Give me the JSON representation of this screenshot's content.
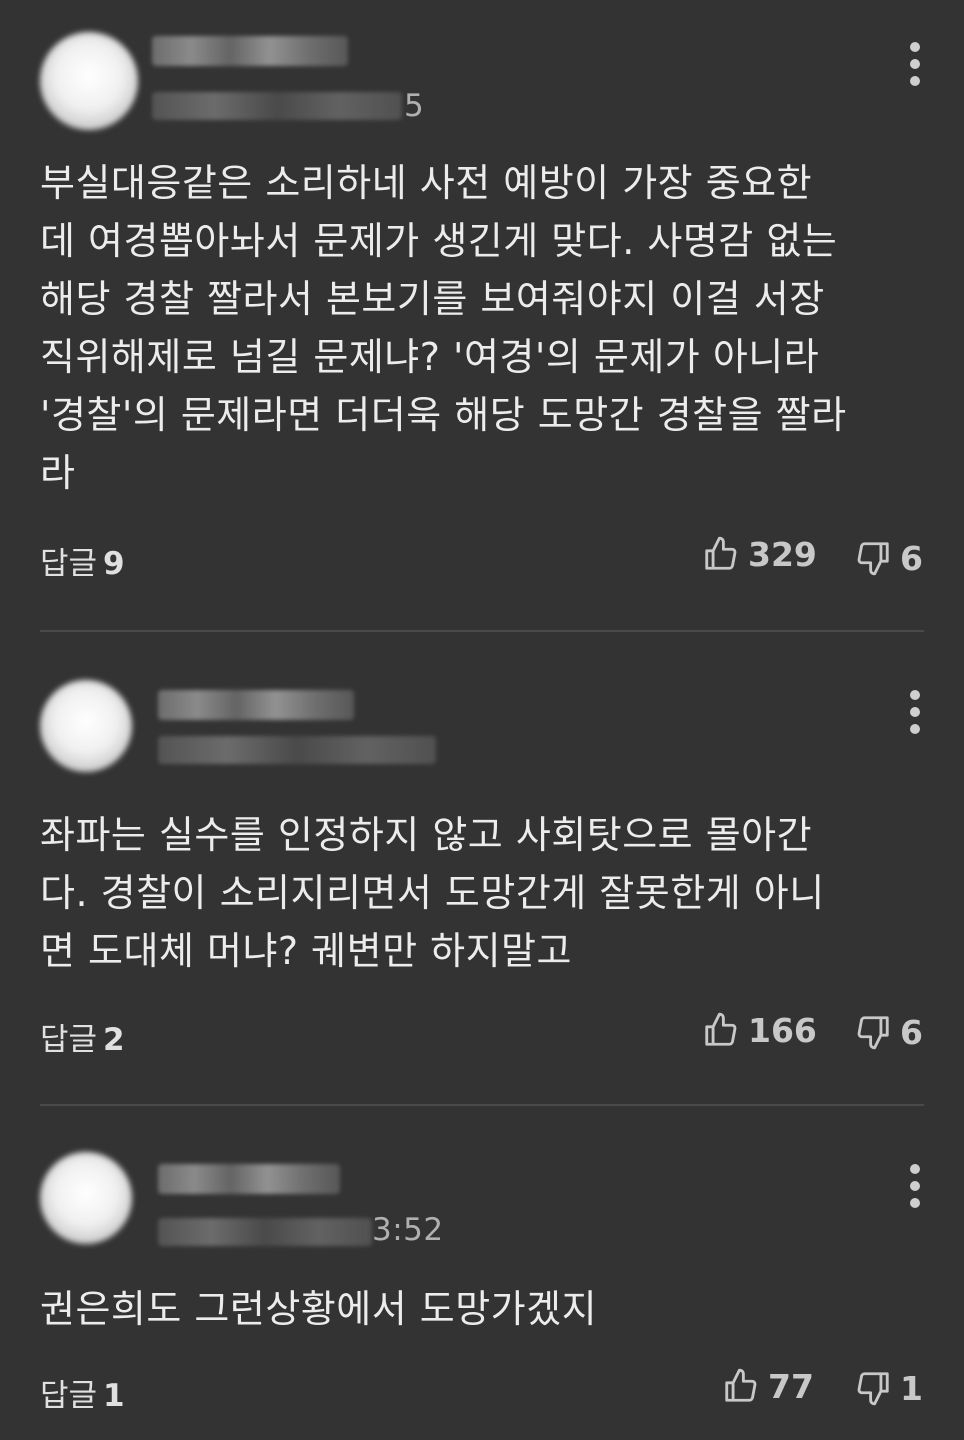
{
  "comments": [
    {
      "time_tail": "5",
      "text": "부실대응같은 소리하네 사전 예방이 가장 중요한\n데 여경뽑아놔서 문제가 생긴게 맞다. 사명감 없는\n해당 경찰 짤라서 본보기를 보여줘야지 이걸 서장\n직위해제로 넘길 문제냐? '여경'의 문제가 아니라\n'경찰'의 문제라면 더더욱 해당 도망간 경찰을 짤라\n라",
      "replies_label": "답글",
      "replies_count": "9",
      "likes": "329",
      "dislikes": "6"
    },
    {
      "time_tail": "",
      "text": "좌파는 실수를 인정하지 않고 사회탓으로 몰아간\n다. 경찰이 소리지리면서 도망간게 잘못한게 아니\n면 도대체 머냐? 궤변만 하지말고",
      "replies_label": "답글",
      "replies_count": "2",
      "likes": "166",
      "dislikes": "6"
    },
    {
      "time_tail": "3:52",
      "text": "권은희도 그런상황에서 도망가겠지",
      "replies_label": "답글",
      "replies_count": "1",
      "likes": "77",
      "dislikes": "1"
    }
  ],
  "icons": {
    "more": "more-vertical-icon",
    "like": "thumbs-up-icon",
    "dislike": "thumbs-down-icon"
  },
  "colors": {
    "background": "#333334",
    "text": "#ececec",
    "muted": "#c8c8c8",
    "divider": "#4a4a4a"
  }
}
